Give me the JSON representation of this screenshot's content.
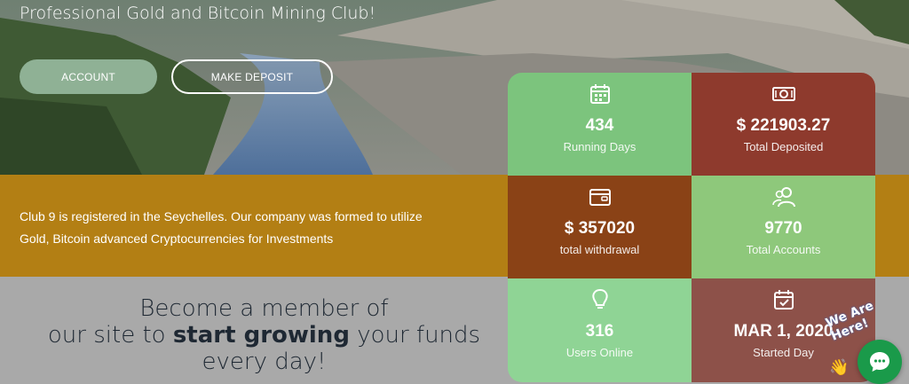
{
  "hero": {
    "subtitle": "Professional Gold and Bitcoin Mining Club!",
    "account_label": "ACCOUNT",
    "deposit_label": "MAKE DEPOSIT"
  },
  "about": {
    "text": "Club 9 is registered in the Seychelles. Our company was formed to utilize Gold, Bitcoin advanced Cryptocurrencies for Investments"
  },
  "join": {
    "line1": "Become a member of",
    "line2_pre": "our site to ",
    "line2_bold": "start growing",
    "line2_post": " your funds",
    "line3": "every day!"
  },
  "stats": [
    {
      "value": "434",
      "label": "Running Days",
      "icon": "calendar-icon",
      "color": "#7cc47d"
    },
    {
      "value": "$ 221903.27",
      "label": "Total Deposited",
      "icon": "cash-icon",
      "color": "#8e3a2d"
    },
    {
      "value": "$ 357020",
      "label": "total withdrawal",
      "icon": "wallet-icon",
      "color": "#8a4216"
    },
    {
      "value": "9770",
      "label": "Total Accounts",
      "icon": "users-icon",
      "color": "#8ec87b"
    },
    {
      "value": "316",
      "label": "Users Online",
      "icon": "lightbulb-icon",
      "color": "#8fd495"
    },
    {
      "value": "MAR 1, 2020",
      "label": "Started Day",
      "icon": "calendar-check-icon",
      "color": "#8d5149"
    }
  ],
  "chat": {
    "tag": "We Are Here!",
    "wave": "👋"
  }
}
